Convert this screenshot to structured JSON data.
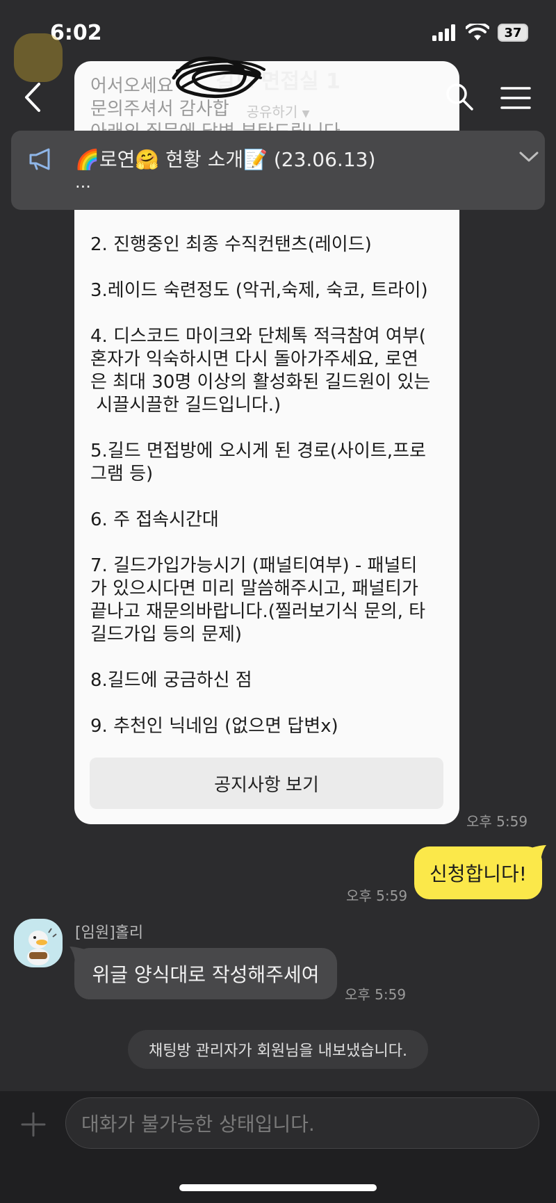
{
  "status_bar": {
    "time": "6:02",
    "battery": "37"
  },
  "header": {
    "title": "길드 면접실 1",
    "share": "공유하기"
  },
  "notice": {
    "text": "🌈로연🤗 현황 소개📝 (23.06.13)",
    "ellipsis": "..."
  },
  "card": {
    "ghost_lines": [
      "어서오세요 ",
      "문의주셔서 감사합",
      "아래의 질문에 답변 부탁드립니다."
    ],
    "items": [
      "2. 진행중인 최종 수직컨탠츠(레이드)",
      "3.레이드 숙련정도 (악귀,숙제, 숙코, 트라이)",
      "4. 디스코드 마이크와 단체톡 적극참여 여부(\n혼자가 익숙하시면 다시 돌아가주세요, 로연\n은 최대 30명 이상의 활성화된 길드원이 있는\n 시끌시끌한 길드입니다.)",
      "5.길드 면접방에 오시게 된 경로(사이트,프로\n그램 등)",
      "6. 주 접속시간대",
      "7. 길드가입가능시기 (패널티여부) - 패널티\n가 있으시다면 미리 말씀해주시고, 패널티가\n끝나고 재문의바랍니다.(찔러보기식 문의, 타\n길드가입 등의 문제)",
      "8.길드에 궁금하신 점",
      "9. 추천인 닉네임 (없으면 답변x)"
    ],
    "button": "공지사항 보기",
    "time": "오후 5:59"
  },
  "my_message": {
    "text": "신청합니다!",
    "time": "오후 5:59"
  },
  "hollie": {
    "name": "[임원]홀리",
    "text": "위글 양식대로 작성해주세여",
    "time": "오후 5:59"
  },
  "system_message": "채팅방 관리자가 회원님을 내보냈습니다.",
  "input": {
    "placeholder": "대화가 불가능한 상태입니다."
  }
}
